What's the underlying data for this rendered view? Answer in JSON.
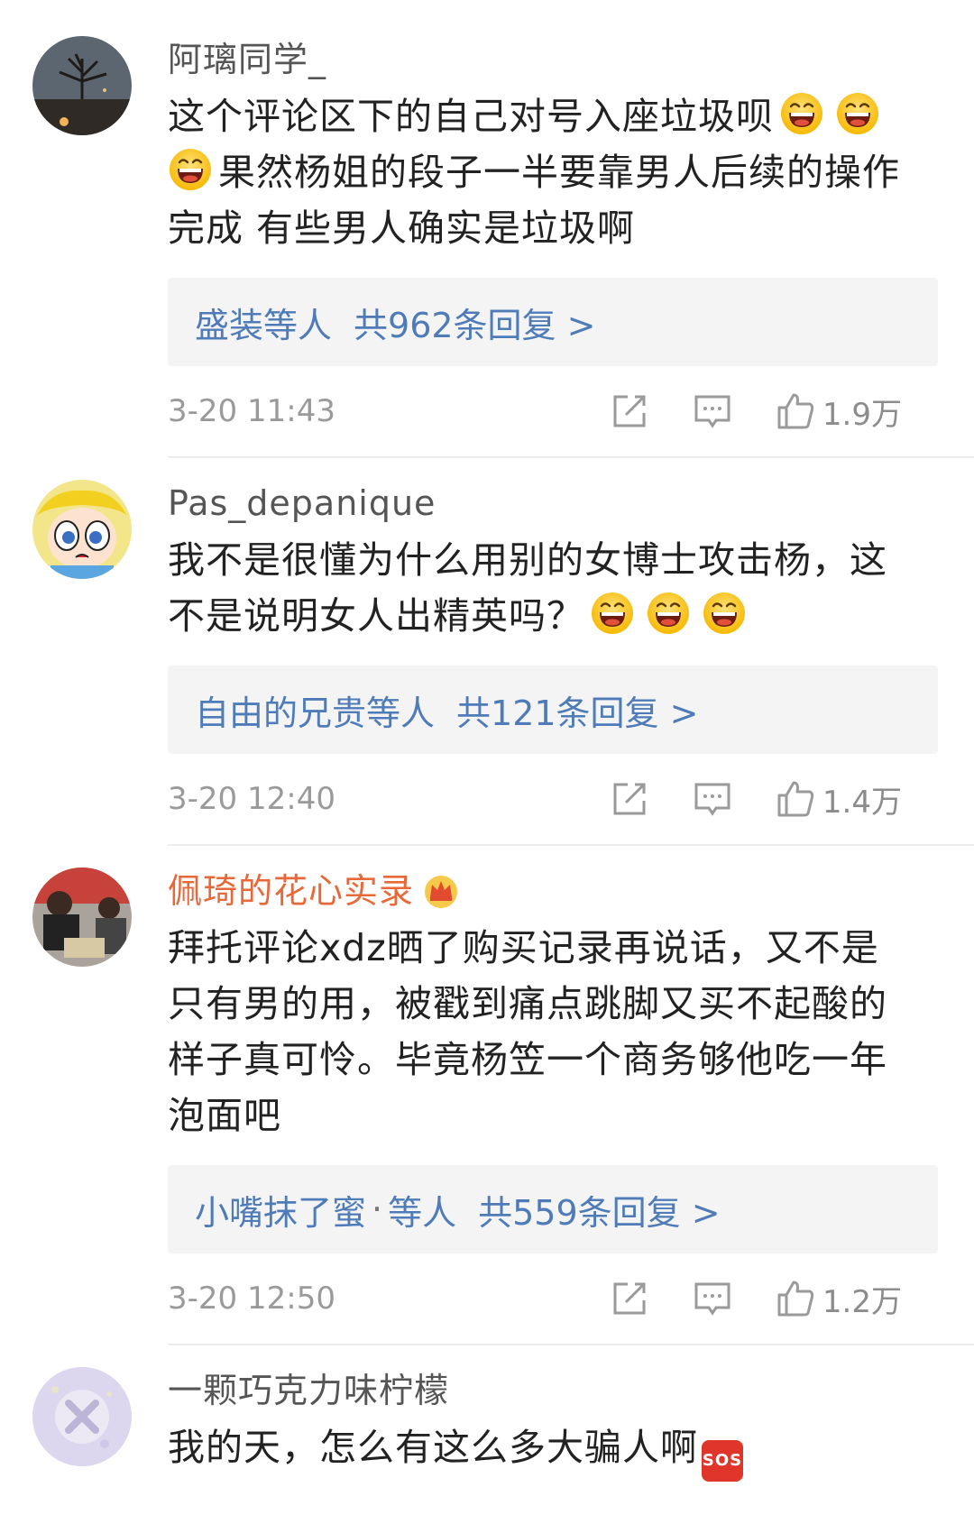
{
  "comments": [
    {
      "username": "阿璃同学_",
      "lines": [
        "这个评论区下的自己对号入座垃圾呗",
        "果然杨姐的段子一半要靠男人后续的操作",
        "完成 有些男人确实是垃圾啊"
      ],
      "reply_users": "盛装等人",
      "reply_count": "共962条回复 >",
      "time": "3-20 11:43",
      "likes": "1.9万"
    },
    {
      "username": "Pas_depanique",
      "lines": [
        "我不是很懂为什么用别的女博士攻击杨，这",
        "不是说明女人出精英吗？"
      ],
      "reply_users": "自由的兄贵等人",
      "reply_count": "共121条回复 >",
      "time": "3-20 12:40",
      "likes": "1.4万"
    },
    {
      "username": "佩琦的花心实录",
      "lines": [
        "拜托评论xdz晒了购买记录再说话，又不是",
        "只有男的用，被戳到痛点跳脚又买不起酸的",
        "样子真可怜。毕竟杨笠一个商务够他吃一年",
        "泡面吧"
      ],
      "reply_users": "小嘴抹了蜜",
      "reply_sep": "·",
      "reply_users_suffix": "等人",
      "reply_count": "共559条回复 >",
      "time": "3-20 12:50",
      "likes": "1.2万"
    },
    {
      "username": "一颗巧克力味柠檬",
      "lines": [
        "我的天，怎么有这么多大骗人啊"
      ],
      "sos_label": "SOS"
    }
  ],
  "icons": {
    "laugh": "laughing-emoji",
    "share": "share-icon",
    "reply": "comment-icon",
    "like": "thumbs-up-icon",
    "crown": "crown-badge-icon",
    "sos": "sos-emoji"
  },
  "colors": {
    "link": "#4f7cb8",
    "vip_name": "#e8683a",
    "meta": "#9a9a9a"
  }
}
